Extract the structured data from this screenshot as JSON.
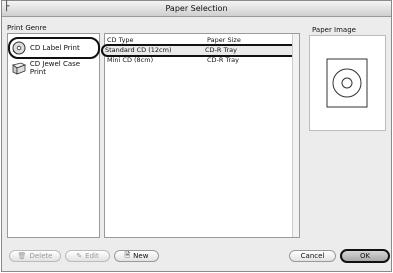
{
  "window": {
    "title": "Paper Selection",
    "corner_mark": "├"
  },
  "labels": {
    "print_genre": "Print Genre",
    "paper_image": "Paper Image"
  },
  "genres": [
    {
      "label": "CD Label Print",
      "icon": "cd-icon",
      "selected": true
    },
    {
      "label": "CD Jewel Case Print",
      "icon": "jewel-case-icon",
      "selected": false
    }
  ],
  "paper_list": {
    "headers": {
      "type": "CD Type",
      "size": "Paper Size"
    },
    "rows": [
      {
        "type": "Standard CD (12cm)",
        "size": "CD-R Tray",
        "selected": true
      },
      {
        "type": "Mini CD (8cm)",
        "size": "CD-R Tray",
        "selected": false
      }
    ]
  },
  "buttons": {
    "delete": "Delete",
    "edit": "Edit",
    "new": "New",
    "cancel": "Cancel",
    "ok": "OK"
  }
}
